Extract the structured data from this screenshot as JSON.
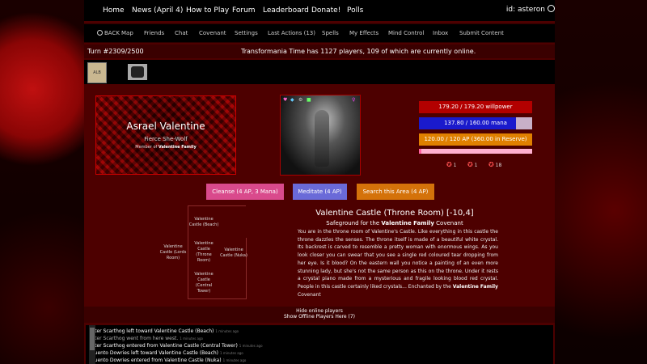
{
  "topnav": {
    "items": [
      "Home",
      "News (April 4)",
      "How to Play",
      "Forum",
      "Leaderboard",
      "Donate!",
      "Polls"
    ],
    "user": "id: asteron"
  },
  "subnav": {
    "items": [
      "BACK",
      "Map",
      "Friends",
      "Chat",
      "Covenant",
      "Settings",
      "Last Actions (13)",
      "Spells",
      "My Effects",
      "Mind Control",
      "Inbox",
      "Submit Content"
    ]
  },
  "turnbar": {
    "turn": "Turn #2309/2500",
    "online": "Transformania Time has 1127 players, 109 of which are currently online."
  },
  "effects": {
    "badge1": "ALB"
  },
  "banner": {
    "name": "Asrael Valentine",
    "form": "Fierce She-Wolf",
    "member_prefix": "Member of",
    "covenant": "Valentine Family"
  },
  "stats": {
    "willpower": "179.20 / 179.20 willpower",
    "mana": "137.80 / 160.00 mana",
    "mana_fraction": 0.86,
    "ap": "120.00 / 120 AP (360.00 in Reserve)",
    "xp_fraction": 0.02,
    "counts": [
      "1",
      "1",
      "18"
    ]
  },
  "actions": {
    "cleanse": "Cleanse (4 AP, 3 Mana)",
    "meditate": "Meditate (4 AP)",
    "search": "Search this Area (4 AP)"
  },
  "map": {
    "north": "Valentine Castle (Beach)",
    "west": "Valentine Castle (Lords Room)",
    "center": "Valentine Castle (Throne Room)",
    "east": "Valentine Castle (Nuka)",
    "south": "Valentine Castle (Central Tower)"
  },
  "location": {
    "title": "Valentine Castle (Throne Room) [-10,4]",
    "safeground_prefix": "Safeground for the",
    "safeground_covenant": "Valentine Family",
    "safeground_suffix": "Covenant",
    "description": "You are in the throne room of Valentine's Castle. Like everything in this castle the throne dazzles the senses. The throne itself is made of a beautiful white crystal. Its backrest is carved to resemble a pretty woman with enormous wings. As you look closer you can swear that you see a single red coloured tear dropping from her eye. Is it blood? On the eastern wall you notice a painting of an even more stunning lady, but she's not the same person as this on the throne. Under it rests a crystal piano made from a mysterious and fragile looking blood red crystal. People in this castle certainly liked crystals...",
    "enchanted_prefix": "Enchanted by the",
    "enchanted_covenant": "Valentine Family",
    "enchanted_suffix": "Covenant"
  },
  "online": {
    "hide": "Hide online players",
    "show_offline": "Show Offline Players Here (7)"
  },
  "log": [
    {
      "text": "Peter Scarthog left toward Valentine Castle (Beach)",
      "time": "1 minutes ago"
    },
    {
      "text": "Peter Scarthog went from here west.",
      "time": "1 minutes ago"
    },
    {
      "text": "Peter Scarthog entered from Valentine Castle (Central Tower)",
      "time": "1 minutes ago"
    },
    {
      "text": "Cruento Dowries left toward Valentine Castle (Beach)",
      "time": "1 minutes ago"
    },
    {
      "text": "Cruento Dowries entered from Valentine Castle (Nuka)",
      "time": "1 minutes ago"
    }
  ],
  "colors": {
    "willpower": "#b30000",
    "mana": "#1a1acc",
    "ap": "#e08000",
    "cleanse": "#d94a8c",
    "meditate": "#6a6ad8",
    "search": "#d4720a"
  }
}
